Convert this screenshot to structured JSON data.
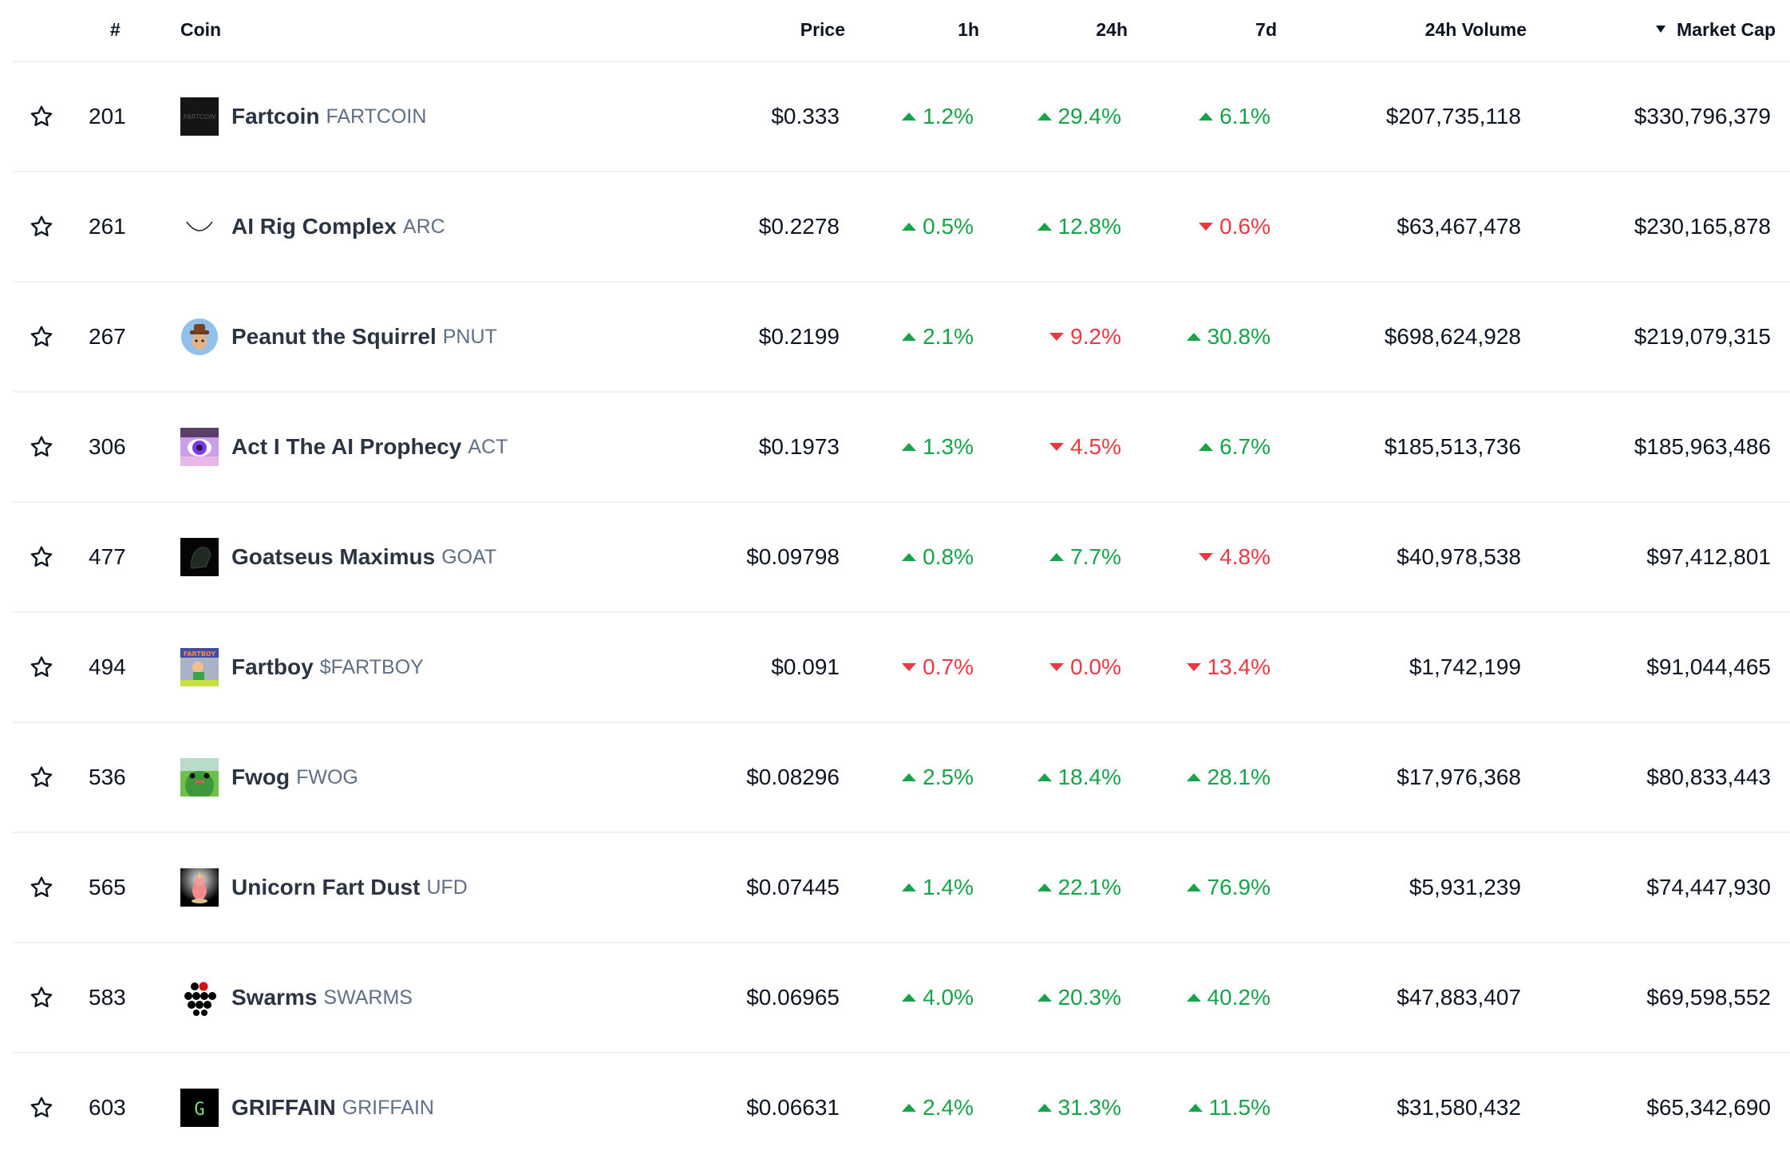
{
  "header": {
    "rank": "#",
    "coin": "Coin",
    "price": "Price",
    "h1": "1h",
    "h24": "24h",
    "d7": "7d",
    "volume": "24h Volume",
    "market_cap": "Market Cap",
    "sorted_by": "Market Cap",
    "sort_direction": "desc"
  },
  "colors": {
    "up": "#16a34a",
    "down": "#ea3943",
    "text": "#0d1421",
    "symbol": "#5f6f86",
    "divider": "#eff2f5"
  },
  "rows": [
    {
      "rank": "201",
      "name": "Fartcoin",
      "symbol": "FARTCOIN",
      "icon": "fartcoin-logo",
      "price": "$0.333",
      "h1": {
        "value": "1.2%",
        "dir": "up"
      },
      "h24": {
        "value": "29.4%",
        "dir": "up"
      },
      "d7": {
        "value": "6.1%",
        "dir": "up"
      },
      "volume": "$207,735,118",
      "market_cap": "$330,796,379"
    },
    {
      "rank": "261",
      "name": "AI Rig Complex",
      "symbol": "ARC",
      "icon": "arc-logo",
      "price": "$0.2278",
      "h1": {
        "value": "0.5%",
        "dir": "up"
      },
      "h24": {
        "value": "12.8%",
        "dir": "up"
      },
      "d7": {
        "value": "0.6%",
        "dir": "down"
      },
      "volume": "$63,467,478",
      "market_cap": "$230,165,878"
    },
    {
      "rank": "267",
      "name": "Peanut the Squirrel",
      "symbol": "PNUT",
      "icon": "pnut-logo",
      "price": "$0.2199",
      "h1": {
        "value": "2.1%",
        "dir": "up"
      },
      "h24": {
        "value": "9.2%",
        "dir": "down"
      },
      "d7": {
        "value": "30.8%",
        "dir": "up"
      },
      "volume": "$698,624,928",
      "market_cap": "$219,079,315"
    },
    {
      "rank": "306",
      "name": "Act I The AI Prophecy",
      "symbol": "ACT",
      "icon": "act-logo",
      "price": "$0.1973",
      "h1": {
        "value": "1.3%",
        "dir": "up"
      },
      "h24": {
        "value": "4.5%",
        "dir": "down"
      },
      "d7": {
        "value": "6.7%",
        "dir": "up"
      },
      "volume": "$185,513,736",
      "market_cap": "$185,963,486"
    },
    {
      "rank": "477",
      "name": "Goatseus Maximus",
      "symbol": "GOAT",
      "icon": "goat-logo",
      "price": "$0.09798",
      "h1": {
        "value": "0.8%",
        "dir": "up"
      },
      "h24": {
        "value": "7.7%",
        "dir": "up"
      },
      "d7": {
        "value": "4.8%",
        "dir": "down"
      },
      "volume": "$40,978,538",
      "market_cap": "$97,412,801"
    },
    {
      "rank": "494",
      "name": "Fartboy",
      "symbol": "$FARTBOY",
      "icon": "fartboy-logo",
      "price": "$0.091",
      "h1": {
        "value": "0.7%",
        "dir": "down"
      },
      "h24": {
        "value": "0.0%",
        "dir": "down"
      },
      "d7": {
        "value": "13.4%",
        "dir": "down"
      },
      "volume": "$1,742,199",
      "market_cap": "$91,044,465"
    },
    {
      "rank": "536",
      "name": "Fwog",
      "symbol": "FWOG",
      "icon": "fwog-logo",
      "price": "$0.08296",
      "h1": {
        "value": "2.5%",
        "dir": "up"
      },
      "h24": {
        "value": "18.4%",
        "dir": "up"
      },
      "d7": {
        "value": "28.1%",
        "dir": "up"
      },
      "volume": "$17,976,368",
      "market_cap": "$80,833,443"
    },
    {
      "rank": "565",
      "name": "Unicorn Fart Dust",
      "symbol": "UFD",
      "icon": "ufd-logo",
      "price": "$0.07445",
      "h1": {
        "value": "1.4%",
        "dir": "up"
      },
      "h24": {
        "value": "22.1%",
        "dir": "up"
      },
      "d7": {
        "value": "76.9%",
        "dir": "up"
      },
      "volume": "$5,931,239",
      "market_cap": "$74,447,930"
    },
    {
      "rank": "583",
      "name": "Swarms",
      "symbol": "SWARMS",
      "icon": "swarms-logo",
      "price": "$0.06965",
      "h1": {
        "value": "4.0%",
        "dir": "up"
      },
      "h24": {
        "value": "20.3%",
        "dir": "up"
      },
      "d7": {
        "value": "40.2%",
        "dir": "up"
      },
      "volume": "$47,883,407",
      "market_cap": "$69,598,552"
    },
    {
      "rank": "603",
      "name": "GRIFFAIN",
      "symbol": "GRIFFAIN",
      "icon": "griffain-logo",
      "price": "$0.06631",
      "h1": {
        "value": "2.4%",
        "dir": "up"
      },
      "h24": {
        "value": "31.3%",
        "dir": "up"
      },
      "d7": {
        "value": "11.5%",
        "dir": "up"
      },
      "volume": "$31,580,432",
      "market_cap": "$65,342,690"
    }
  ]
}
